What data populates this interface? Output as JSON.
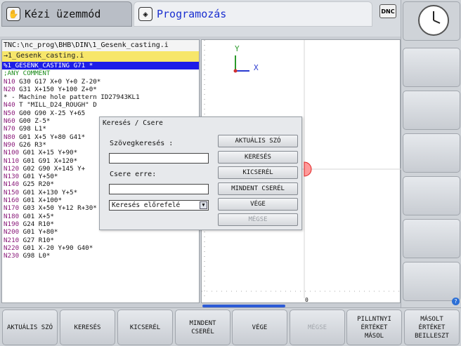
{
  "header": {
    "mode_manual": "Kézi üzemmód",
    "mode_program": "Programozás",
    "dnc_label": "DNC"
  },
  "program": {
    "path": "TNC:\\nc_prog\\BHB\\DIN\\1_Gesenk_casting.i",
    "filename": "→1_Gesenk_casting.i",
    "lines": [
      {
        "n": "%1_GESENK_CASTING G71",
        "rest": " *",
        "selected": true
      },
      {
        "n": "",
        "rest": ";ANY COMMENT",
        "comment": true
      },
      {
        "n": "N10",
        "rest": " G30 G17 X+0 Y+0 Z-20*"
      },
      {
        "n": "N20",
        "rest": " G31 X+150 Y+100 Z+0*"
      },
      {
        "n": "",
        "rest": "* - Machine hole pattern ID27943KL1"
      },
      {
        "n": "N40",
        "rest": " T \"MILL_D24_ROUGH\" D"
      },
      {
        "n": "N50",
        "rest": " G00 G90 X-25 Y+65"
      },
      {
        "n": "N60",
        "rest": " G00 Z-5*"
      },
      {
        "n": "N70",
        "rest": " G98 L1*"
      },
      {
        "n": "N80",
        "rest": " G01 X+5 Y+80 G41*"
      },
      {
        "n": "N90",
        "rest": " G26 R3*"
      },
      {
        "n": "N100",
        "rest": " G01 X+15 Y+90*"
      },
      {
        "n": "N110",
        "rest": " G01 G91 X+120*"
      },
      {
        "n": "N120",
        "rest": " G02 G90 X+145 Y+"
      },
      {
        "n": "N130",
        "rest": " G01 Y+50*"
      },
      {
        "n": "N140",
        "rest": " G25 R20*"
      },
      {
        "n": "N150",
        "rest": " G01 X+130 Y+5*"
      },
      {
        "n": "N160",
        "rest": " G01 X+100*"
      },
      {
        "n": "N170",
        "rest": " G03 X+50 Y+12 R+30*"
      },
      {
        "n": "N180",
        "rest": " G01 X+5*"
      },
      {
        "n": "N190",
        "rest": " G24 R10*"
      },
      {
        "n": "N200",
        "rest": " G01 Y+80*"
      },
      {
        "n": "N210",
        "rest": " G27 R10*"
      },
      {
        "n": "N220",
        "rest": " G01 X-20 Y+90 G40*"
      },
      {
        "n": "N230",
        "rest": " G98 L0*"
      }
    ]
  },
  "graphic": {
    "axis_y": "Y",
    "axis_x": "X",
    "ruler_zero": "0"
  },
  "dialog": {
    "title": "Keresés / Csere",
    "search_label": "Szövegkeresés :",
    "search_value": "",
    "replace_label": "Csere erre:",
    "replace_value": "",
    "direction": "Keresés előrefelé",
    "buttons": [
      "AKTUÁLIS SZÓ",
      "KERESÉS",
      "KICSERÉL",
      "MINDENT CSERÉL",
      "VÉGE",
      "MÉGSE"
    ]
  },
  "softkeys": [
    {
      "label": "AKTUÁLIS SZÓ",
      "enabled": true
    },
    {
      "label": "KERESÉS",
      "enabled": true
    },
    {
      "label": "KICSERÉL",
      "enabled": true
    },
    {
      "label": "MINDENT\nCSERÉL",
      "enabled": true
    },
    {
      "label": "VÉGE",
      "enabled": true
    },
    {
      "label": "MÉGSE",
      "enabled": false
    },
    {
      "label": "PILLNTNYI\nÉRTÉKET\nMÁSOL",
      "enabled": true
    },
    {
      "label": "MÁSOLT\nÉRTÉKET\nBEILLESZT",
      "enabled": true
    }
  ],
  "colors": {
    "selection": "#1d1de8",
    "filename_bg": "#f7e66a",
    "program_tab_text": "#1a2fd0"
  }
}
